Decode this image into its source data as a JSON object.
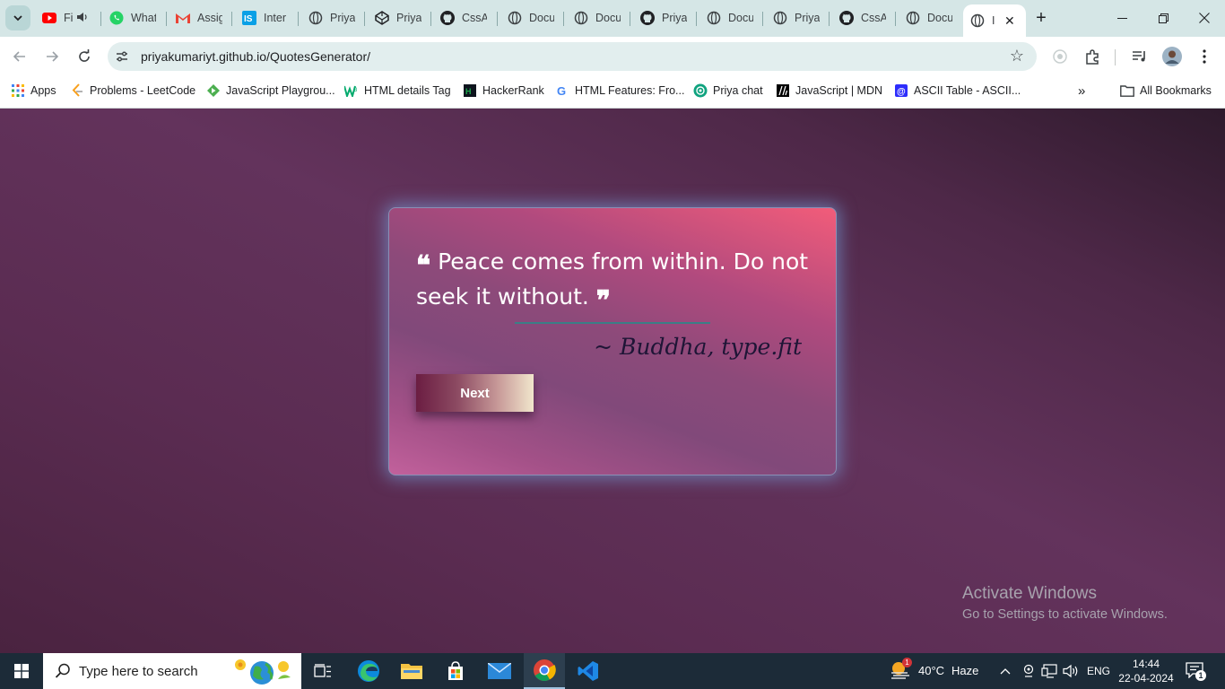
{
  "browser": {
    "tabs": [
      {
        "title": "Fi",
        "icon": "youtube-icon"
      },
      {
        "title": "What",
        "icon": "whatsapp-icon"
      },
      {
        "title": "Assig",
        "icon": "gmail-icon"
      },
      {
        "title": "Inter",
        "icon": "internshala-icon"
      },
      {
        "title": "Priya",
        "icon": "globe-icon"
      },
      {
        "title": "Priya",
        "icon": "codepen-icon"
      },
      {
        "title": "CssA",
        "icon": "github-icon"
      },
      {
        "title": "Docu",
        "icon": "globe-icon"
      },
      {
        "title": "Docu",
        "icon": "globe-icon"
      },
      {
        "title": "Priya",
        "icon": "github-icon"
      },
      {
        "title": "Docu",
        "icon": "globe-icon"
      },
      {
        "title": "Priya",
        "icon": "globe-icon"
      },
      {
        "title": "CssA",
        "icon": "github-icon"
      },
      {
        "title": "Docu",
        "icon": "globe-icon"
      }
    ],
    "active_tab": {
      "title": "I",
      "icon": "globe-icon"
    },
    "url": "priyakumariyt.github.io/QuotesGenerator/",
    "bookmarks": [
      {
        "label": "Apps"
      },
      {
        "label": "Problems - LeetCode"
      },
      {
        "label": "JavaScript Playgrou..."
      },
      {
        "label": "HTML details Tag"
      },
      {
        "label": "HackerRank"
      },
      {
        "label": "HTML Features: Fro..."
      },
      {
        "label": "Priya chat"
      },
      {
        "label": "JavaScript | MDN"
      },
      {
        "label": "ASCII Table - ASCII..."
      }
    ],
    "all_bookmarks": "All Bookmarks"
  },
  "page": {
    "quote": "Peace comes from within. Do not seek it without.",
    "author": "~ Buddha, type.fit",
    "next_button": "Next",
    "colors": {
      "card_top": "#f25c7a",
      "card_mid": "#8d4a7a",
      "card_bottom": "#c2619c",
      "author": "#1e1536",
      "underline": "#3b7f86"
    }
  },
  "watermark": {
    "line1": "Activate Windows",
    "line2": "Go to Settings to activate Windows."
  },
  "taskbar": {
    "search_placeholder": "Type here to search",
    "weather_temp": "40°C",
    "weather_desc": "Haze",
    "weather_badge": "1",
    "language": "ENG",
    "time": "14:44",
    "date": "22-04-2024",
    "notification_count": "1"
  }
}
